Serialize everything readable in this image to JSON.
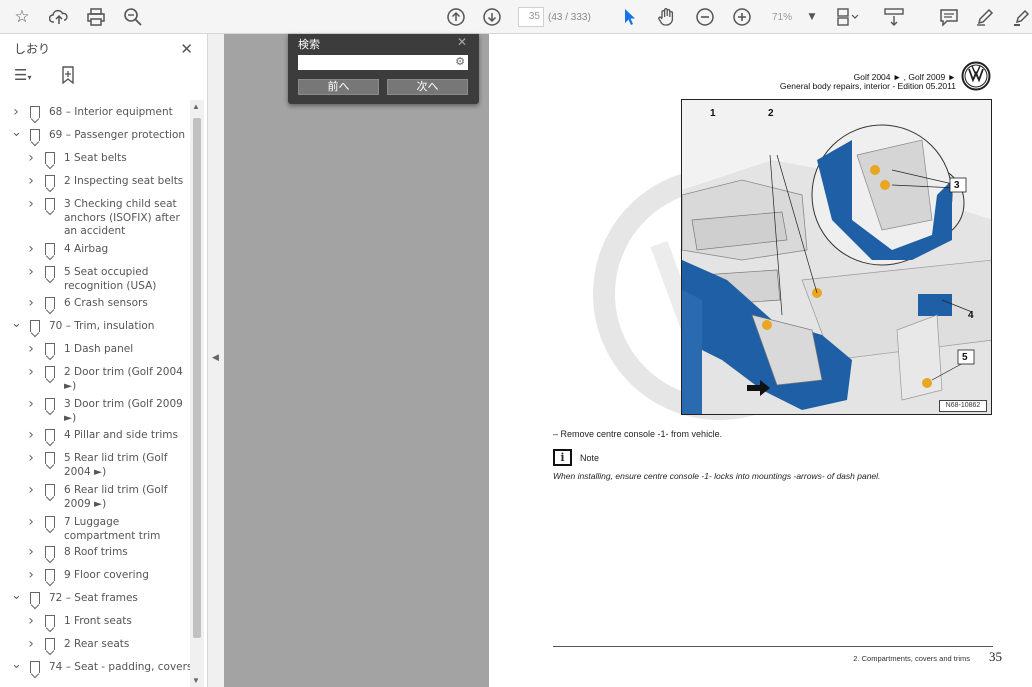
{
  "toolbar": {
    "page_current": "35",
    "page_total": "(43 / 333)",
    "zoom": "71%"
  },
  "sidebar": {
    "title": "しおり",
    "items": [
      {
        "label": "68 – Interior equipment",
        "level": 0,
        "expanded": false
      },
      {
        "label": "69 – Passenger protection",
        "level": 0,
        "expanded": true
      },
      {
        "label": "1 Seat belts",
        "level": 1,
        "expanded": false
      },
      {
        "label": "2 Inspecting seat belts",
        "level": 1,
        "expanded": false
      },
      {
        "label": "3 Checking child seat",
        "label2": "anchors (ISOFIX) after",
        "label3": "an accident",
        "level": 1,
        "expanded": false
      },
      {
        "label": "4 Airbag",
        "level": 1,
        "expanded": false
      },
      {
        "label": "5 Seat occupied",
        "label2": "recognition (USA)",
        "level": 1,
        "expanded": false
      },
      {
        "label": "6 Crash sensors",
        "level": 1,
        "expanded": false
      },
      {
        "label": "70 – Trim, insulation",
        "level": 0,
        "expanded": true
      },
      {
        "label": "1 Dash panel",
        "level": 1,
        "expanded": false
      },
      {
        "label": "2 Door trim (Golf 2004",
        "label2": "►)",
        "level": 1,
        "expanded": false
      },
      {
        "label": "3 Door trim (Golf 2009",
        "label2": "►)",
        "level": 1,
        "expanded": false
      },
      {
        "label": "4 Pillar and side trims",
        "level": 1,
        "expanded": false
      },
      {
        "label": "5 Rear lid trim (Golf",
        "label2": "2004 ►)",
        "level": 1,
        "expanded": false
      },
      {
        "label": "6 Rear lid trim (Golf",
        "label2": "2009 ►)",
        "level": 1,
        "expanded": false
      },
      {
        "label": "7 Luggage",
        "label2": "compartment trim",
        "level": 1,
        "expanded": false
      },
      {
        "label": "8 Roof trims",
        "level": 1,
        "expanded": false
      },
      {
        "label": "9 Floor covering",
        "level": 1,
        "expanded": false
      },
      {
        "label": "72 – Seat frames",
        "level": 0,
        "expanded": true
      },
      {
        "label": "1 Front seats",
        "level": 1,
        "expanded": false
      },
      {
        "label": "2 Rear seats",
        "level": 1,
        "expanded": false
      },
      {
        "label": "74 – Seat - padding, covers",
        "level": 0,
        "expanded": true
      }
    ]
  },
  "search": {
    "title": "検索",
    "prev_label": "前へ",
    "next_label": "次へ"
  },
  "document": {
    "header_line1": "Golf 2004 ► , Golf 2009 ►",
    "header_line2": "General body repairs, interior - Edition 05.2011",
    "figure_code": "N68-10862",
    "figure_labels": [
      "1",
      "2",
      "3",
      "4",
      "5"
    ],
    "instruction": "–   Remove centre console -1- from vehicle.",
    "note_icon": "i",
    "note_label": "Note",
    "note_text": "When installing, ensure centre console -1- locks into mountings -arrows- of dash panel.",
    "footer_text": "2. Compartments, covers and trims",
    "footer_page": "35"
  },
  "colors": {
    "accent": "#1473e6",
    "console_blue": "#1f5fa6",
    "toolbar_bg": "#f5f5f5",
    "viewer_bg": "#a3a3a3",
    "search_bg": "#3c3c3c"
  }
}
